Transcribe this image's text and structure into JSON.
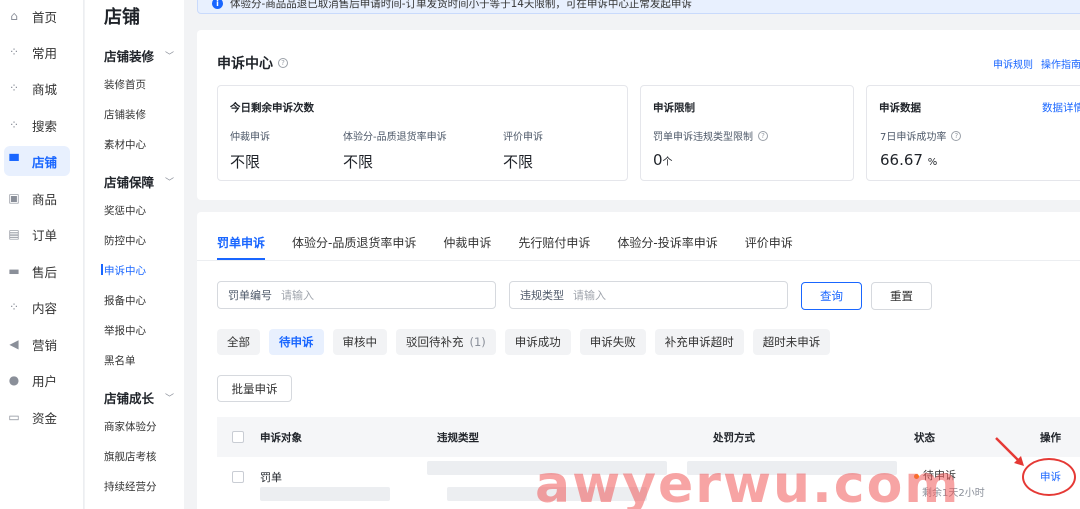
{
  "nav_primary": [
    {
      "label": "首页",
      "icon": "home-icon",
      "glyph": "⌂"
    },
    {
      "label": "常用",
      "icon": "apps-icon",
      "glyph": "⁘"
    },
    {
      "label": "商城",
      "icon": "apps-icon",
      "glyph": "⁘"
    },
    {
      "label": "搜索",
      "icon": "apps-icon",
      "glyph": "⁘"
    },
    {
      "label": "店铺",
      "icon": "store-icon",
      "glyph": "▀"
    },
    {
      "label": "商品",
      "icon": "goods-icon",
      "glyph": "▣"
    },
    {
      "label": "订单",
      "icon": "order-icon",
      "glyph": "▤"
    },
    {
      "label": "售后",
      "icon": "aftersale-icon",
      "glyph": "▬"
    },
    {
      "label": "内容",
      "icon": "content-icon",
      "glyph": "⁘"
    },
    {
      "label": "营销",
      "icon": "megaphone-icon",
      "glyph": "◀"
    },
    {
      "label": "用户",
      "icon": "user-icon",
      "glyph": "●"
    },
    {
      "label": "资金",
      "icon": "wallet-icon",
      "glyph": "▭"
    }
  ],
  "nav_secondary": {
    "title": "店铺",
    "groups": [
      {
        "label": "店铺装修",
        "items": [
          "装修首页",
          "店铺装修",
          "素材中心"
        ]
      },
      {
        "label": "店铺保障",
        "items": [
          "奖惩中心",
          "防控中心",
          "申诉中心",
          "报备中心",
          "举报中心",
          "黑名单"
        ]
      },
      {
        "label": "店铺成长",
        "items": [
          "商家体验分",
          "旗舰店考核",
          "持续经营分"
        ]
      }
    ]
  },
  "notice": {
    "text": "体验分-商品品退已取消售后申请时间-订单发货时间小于等于14天限制，可在申诉中心正常发起申诉"
  },
  "header": {
    "title": "申诉中心",
    "link_rules": "申诉规则",
    "link_guide": "操作指南"
  },
  "stats": {
    "remaining": {
      "title": "今日剩余申诉次数",
      "metrics": [
        {
          "label": "仲裁申诉",
          "value": "不限"
        },
        {
          "label": "体验分-品质退货率申诉",
          "value": "不限"
        },
        {
          "label": "评价申诉",
          "value": "不限"
        }
      ]
    },
    "limit": {
      "title": "申诉限制",
      "metric_label": "罚单申诉违规类型限制",
      "value": "0",
      "unit": "个"
    },
    "data": {
      "title": "申诉数据",
      "link": "数据详情",
      "metric_label": "7日申诉成功率",
      "value": "66.67",
      "unit": "%"
    }
  },
  "tabs": [
    "罚单申诉",
    "体验分-品质退货率申诉",
    "仲裁申诉",
    "先行赔付申诉",
    "体验分-投诉率申诉",
    "评价申诉"
  ],
  "filters": {
    "ticket_label": "罚单编号",
    "ticket_placeholder": "请输入",
    "type_label": "违规类型",
    "type_placeholder": "请输入",
    "query": "查询",
    "reset": "重置"
  },
  "status_chips": [
    {
      "label": "全部"
    },
    {
      "label": "待申诉"
    },
    {
      "label": "审核中"
    },
    {
      "label": "驳回待补充",
      "count": "(1)"
    },
    {
      "label": "申诉成功"
    },
    {
      "label": "申诉失败"
    },
    {
      "label": "补充申诉超时"
    },
    {
      "label": "超时未申诉"
    }
  ],
  "batch_button": "批量申诉",
  "table": {
    "headers": {
      "target": "申诉对象",
      "type": "违规类型",
      "penalty": "处罚方式",
      "status": "状态",
      "action": "操作"
    },
    "rows": [
      {
        "target": "罚单",
        "status": "待申诉",
        "remaining": "剩余1天2小时",
        "action": "申诉"
      }
    ]
  },
  "watermark": "awyerwu.com",
  "colors": {
    "primary": "#1966ff",
    "warning": "#ff7d00",
    "annotation": "#e53935"
  }
}
